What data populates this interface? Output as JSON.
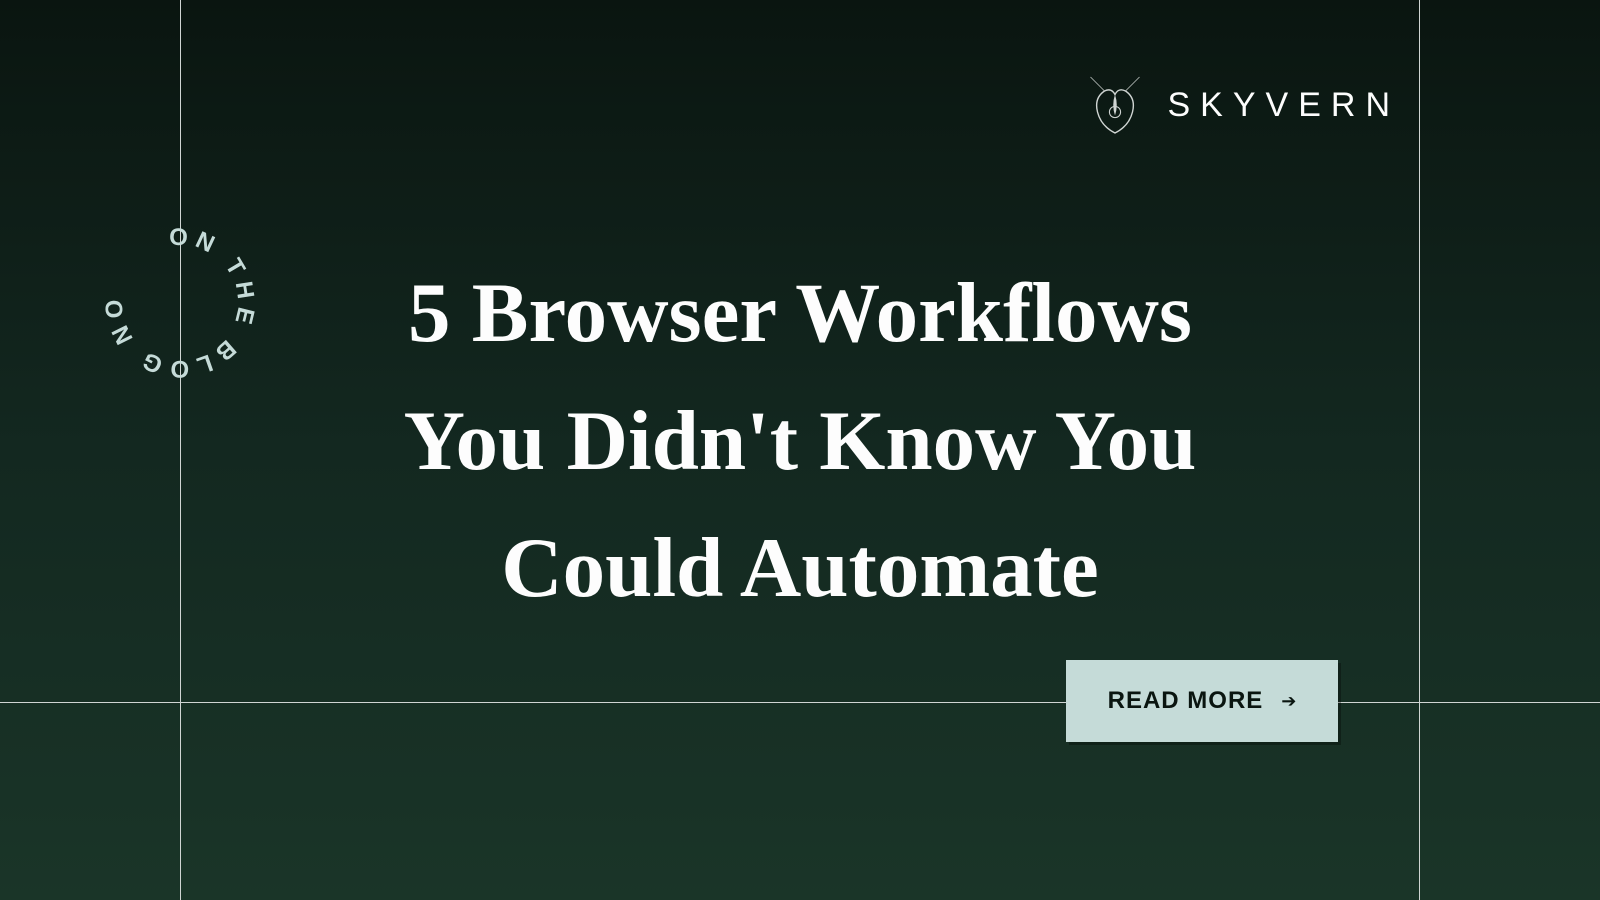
{
  "brand": {
    "name": "SKYVERN"
  },
  "badge": {
    "text": "ON THE BLOG NOW"
  },
  "headline": "5 Browser Workflows You Didn't Know You Could Automate",
  "cta": {
    "label": "READ MORE"
  }
}
